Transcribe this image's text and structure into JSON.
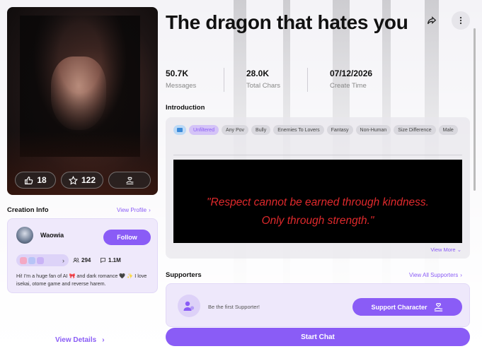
{
  "character": {
    "title": "The dragon that hates you",
    "stats": [
      {
        "value": "50.7K",
        "label": "Messages"
      },
      {
        "value": "28.0K",
        "label": "Total Chars"
      },
      {
        "value": "07/12/2026",
        "label": "Create Time"
      }
    ],
    "cover_actions": {
      "likes": "18",
      "favorites": "122"
    }
  },
  "introduction": {
    "heading": "Introduction",
    "tags": [
      "Unfiltered",
      "Any Pov",
      "Bully",
      "Enemies To Lovers",
      "Fantasy",
      "Non-Human",
      "Size Difference",
      "Male"
    ],
    "quote_line1": "\"Respect cannot be earned through kindness.",
    "quote_line2": "Only through strength.\"",
    "view_more": "View More"
  },
  "creation_info": {
    "heading": "Creation Info",
    "view_profile": "View Profile",
    "creator_name": "Waowia",
    "follow_label": "Follow",
    "followers": "294",
    "chats": "1.1M",
    "bio": "Hi! I'm a huge fan of AI 🎀 and dark romance 🖤 ✨ I love isekai, otome game and reverse harem."
  },
  "view_details": "View Details",
  "supporters": {
    "heading": "Supporters",
    "view_all": "View All Supporters",
    "empty_text": "Be the first Supporter!",
    "support_label": "Support Character"
  },
  "start_chat": "Start Chat",
  "colors": {
    "accent": "#8a5cf6",
    "quote": "#e0292c"
  }
}
